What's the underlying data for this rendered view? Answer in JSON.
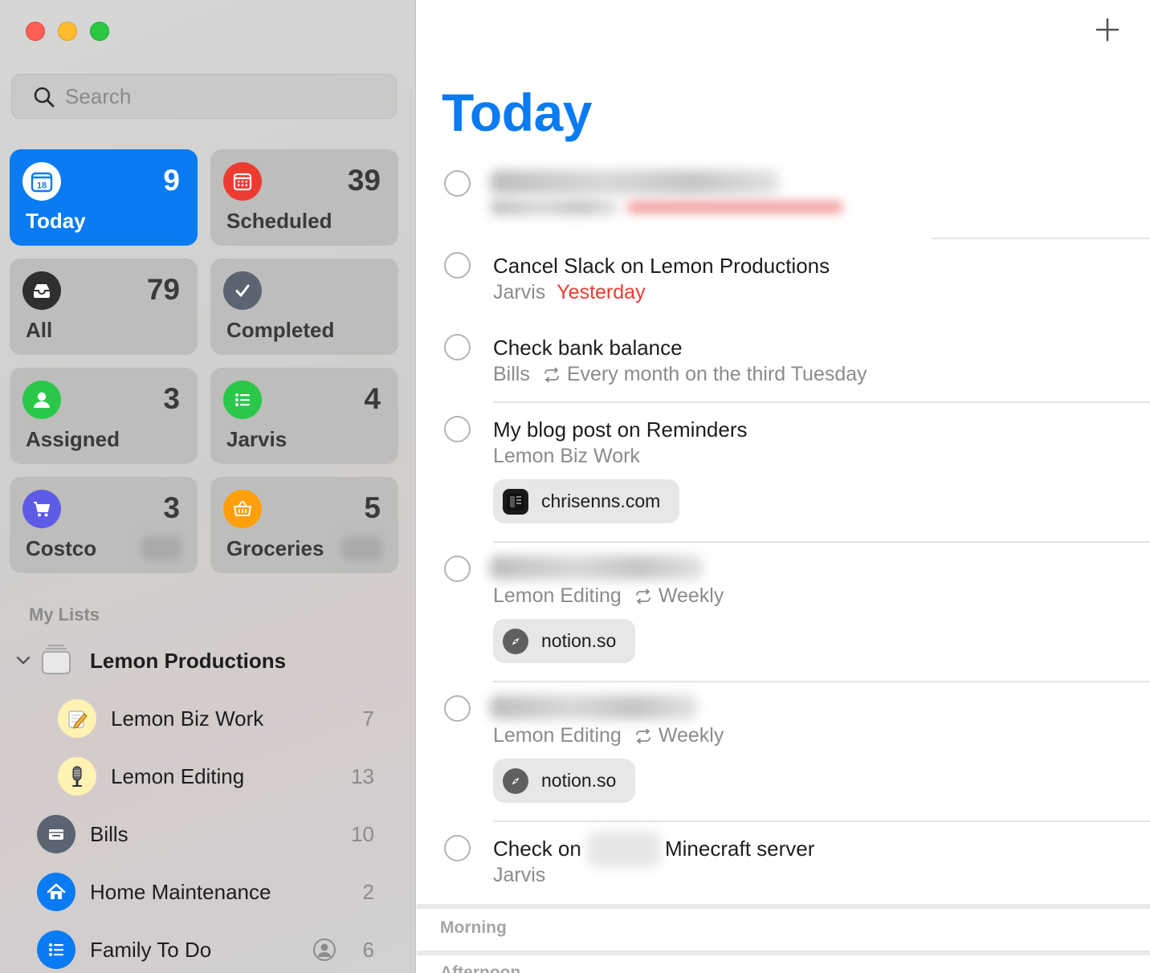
{
  "window": {
    "controls": [
      "close",
      "minimize",
      "zoom"
    ]
  },
  "search": {
    "placeholder": "Search"
  },
  "smart_lists": [
    {
      "label": "Today",
      "count": "9",
      "icon": "calendar-18-icon",
      "color": "#0a7bf3",
      "active": true,
      "icon_text": "18"
    },
    {
      "label": "Scheduled",
      "count": "39",
      "icon": "calendar-icon",
      "color": "#ee3b32"
    },
    {
      "label": "All",
      "count": "79",
      "icon": "tray-icon",
      "color": "#3a3a3a"
    },
    {
      "label": "Completed",
      "count": "",
      "icon": "checkmark-icon",
      "color": "#5b6470"
    },
    {
      "label": "Assigned",
      "count": "3",
      "icon": "person-icon",
      "color": "#2ac849"
    },
    {
      "label": "Jarvis",
      "count": "4",
      "icon": "list-bullet-icon",
      "color": "#2ac849"
    },
    {
      "label": "Costco",
      "count": "3",
      "icon": "cart-icon",
      "color": "#5e5ce6"
    },
    {
      "label": "Groceries",
      "count": "5",
      "icon": "basket-icon",
      "color": "#ff9f0a"
    }
  ],
  "my_lists_header": "My Lists",
  "groups": [
    {
      "label": "Lemon Productions",
      "icon": "folder-stack-icon",
      "expanded": true
    }
  ],
  "lists": [
    {
      "label": "Lemon Biz Work",
      "count": "7",
      "icon": "memo-emoji-icon",
      "color": "#fff2b3",
      "indented": true
    },
    {
      "label": "Lemon Editing",
      "count": "13",
      "icon": "microphone-emoji-icon",
      "color": "#fff2b3",
      "indented": true
    },
    {
      "label": "Bills",
      "count": "10",
      "icon": "tray-icon",
      "color": "#5b6470"
    },
    {
      "label": "Home Maintenance",
      "count": "2",
      "icon": "house-icon",
      "color": "#0a7bf3"
    },
    {
      "label": "Family To Do",
      "count": "6",
      "icon": "list-bullet-icon",
      "color": "#0a7bf3",
      "shared": true
    }
  ],
  "main": {
    "title": "Today",
    "add_label": "+",
    "tasks": [
      {
        "title": "",
        "blurred": true
      },
      {
        "title": "Cancel Slack on Lemon Productions",
        "list": "Jarvis",
        "due": "Yesterday"
      },
      {
        "title": "Check bank balance",
        "list": "Bills",
        "repeat": "Every month on the third Tuesday"
      },
      {
        "title": "My blog post on Reminders",
        "list": "Lemon Biz Work",
        "link": "chrisenns.com"
      },
      {
        "title": "",
        "list": "Lemon Editing",
        "repeat": "Weekly",
        "link": "notion.so",
        "blurred": true
      },
      {
        "title": "",
        "list": "Lemon Editing",
        "repeat": "Weekly",
        "link": "notion.so",
        "blurred": true
      },
      {
        "title_before": "Check on",
        "title_after": "Minecraft server",
        "list": "Jarvis"
      }
    ],
    "sections": [
      "Morning",
      "Afternoon"
    ]
  },
  "colors": {
    "accent": "#0a7bf3",
    "overdue": "#ee3b32",
    "secondary_text": "#8b8b8b"
  }
}
